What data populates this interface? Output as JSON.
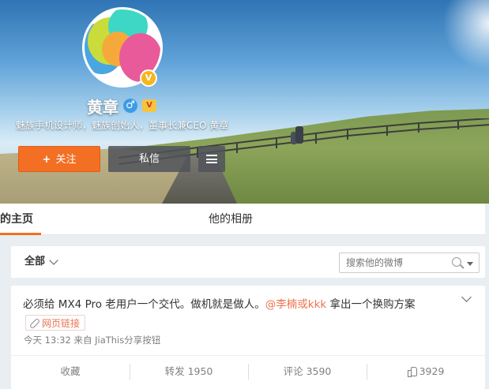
{
  "profile": {
    "name": "黄章",
    "gender_icon": "male-icon",
    "gender_glyph": "♂",
    "vip_icon": "vip-badge-icon",
    "vip_glyph": "V",
    "verified_icon": "verified-badge-icon",
    "verified_glyph": "V",
    "bio": "魅族手机设计师，魅族创始人，董事长兼CEO 黄章"
  },
  "actions": {
    "follow_label": "关注",
    "follow_plus": "+",
    "message_label": "私信",
    "more_icon": "menu-icon"
  },
  "tabs": [
    {
      "label": "的主页",
      "active": true
    },
    {
      "label": "他的相册",
      "active": false
    }
  ],
  "filter": {
    "selected": "全部",
    "search_placeholder": "搜索他的微博"
  },
  "post": {
    "text_before": "必须给 MX4 Pro 老用户一个交代。做机就是做人。",
    "mention": "@李楠或kkk",
    "text_after": " 拿出一个换购方案",
    "link_label": "网页链接",
    "meta": "今天 13:32 来自 JiaThis分享按钮",
    "actions": {
      "favorite": "收藏",
      "repost": "转发 1950",
      "comment": "评论 3590",
      "like": "3929"
    }
  },
  "colors": {
    "accent": "#f36f24",
    "mention": "#eb7350",
    "verified": "#f7b51c"
  }
}
